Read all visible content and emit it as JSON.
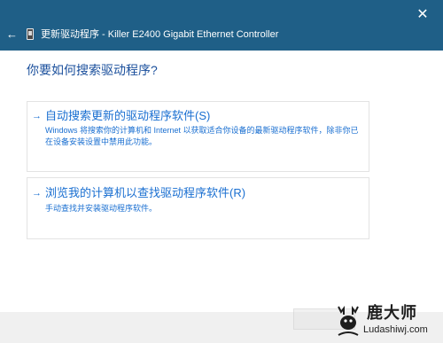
{
  "window": {
    "title": "更新驱动程序 - Killer E2400 Gigabit Ethernet Controller",
    "close_glyph": "✕",
    "back_glyph": "←",
    "titlebar_color": "#1f5f87"
  },
  "main": {
    "heading": "你要如何搜索驱动程序?",
    "options": [
      {
        "arrow": "→",
        "title": "自动搜索更新的驱动程序软件(S)",
        "description": "Windows 将搜索你的计算机和 Internet 以获取适合你设备的最新驱动程序软件，除非你已在设备安装设置中禁用此功能。"
      },
      {
        "arrow": "→",
        "title": "浏览我的计算机以查找驱动程序软件(R)",
        "description": "手动查找并安装驱动程序软件。"
      }
    ],
    "accent_color": "#1a6fd1"
  },
  "watermark": {
    "brand_cn": "鹿大师",
    "brand_en": "Ludashiwj.com"
  },
  "icons": [
    "back-arrow-icon",
    "device-icon",
    "close-icon",
    "arrow-right-icon"
  ]
}
